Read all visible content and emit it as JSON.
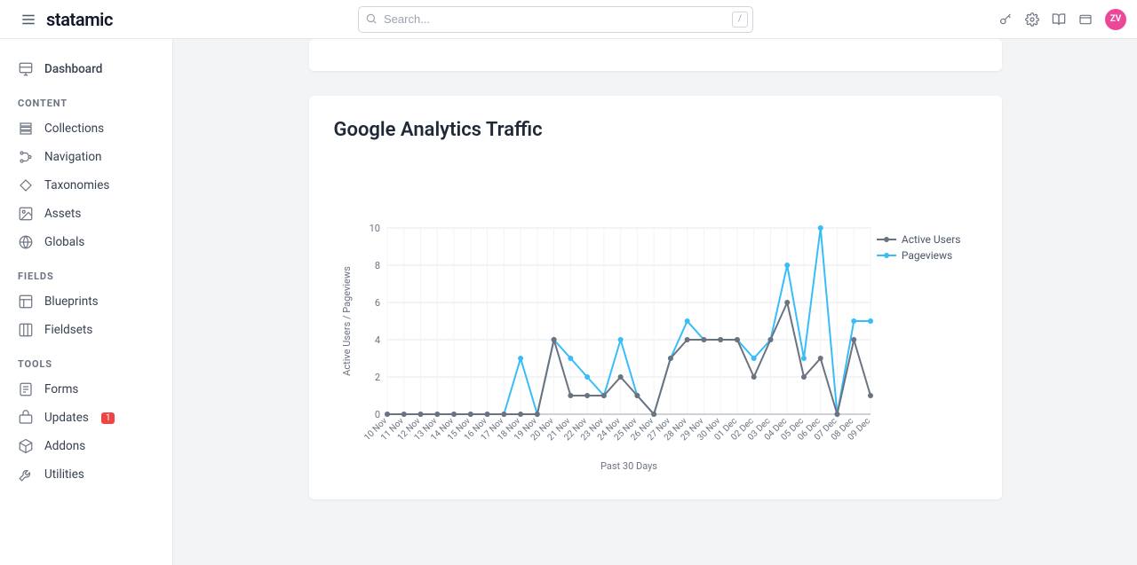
{
  "brand": "statamic",
  "search": {
    "placeholder": "Search...",
    "slash": "/"
  },
  "avatar": "ZV",
  "sidebar": {
    "dashboard": "Dashboard",
    "sections": [
      {
        "label": "CONTENT",
        "items": [
          "Collections",
          "Navigation",
          "Taxonomies",
          "Assets",
          "Globals"
        ]
      },
      {
        "label": "FIELDS",
        "items": [
          "Blueprints",
          "Fieldsets"
        ]
      },
      {
        "label": "TOOLS",
        "items": [
          "Forms",
          "Updates",
          "Addons",
          "Utilities"
        ]
      }
    ],
    "updates_badge": "1"
  },
  "card": {
    "title": "Google Analytics Traffic"
  },
  "chart_data": {
    "type": "line",
    "title": "Google Analytics Traffic",
    "xlabel": "Past 30 Days",
    "ylabel": "Active Users / Pageviews",
    "ylim": [
      0,
      10
    ],
    "yticks": [
      0,
      2,
      4,
      6,
      8,
      10
    ],
    "categories": [
      "10 Nov",
      "11 Nov",
      "12 Nov",
      "13 Nov",
      "14 Nov",
      "15 Nov",
      "16 Nov",
      "17 Nov",
      "18 Nov",
      "19 Nov",
      "20 Nov",
      "21 Nov",
      "22 Nov",
      "23 Nov",
      "24 Nov",
      "25 Nov",
      "26 Nov",
      "27 Nov",
      "28 Nov",
      "29 Nov",
      "30 Nov",
      "01 Dec",
      "02 Dec",
      "03 Dec",
      "04 Dec",
      "05 Dec",
      "06 Dec",
      "07 Dec",
      "08 Dec",
      "09 Dec"
    ],
    "series": [
      {
        "name": "Active Users",
        "color": "#6b7280",
        "values": [
          0,
          0,
          0,
          0,
          0,
          0,
          0,
          0,
          0,
          0,
          4,
          1,
          1,
          1,
          2,
          1,
          0,
          3,
          4,
          4,
          4,
          4,
          2,
          4,
          6,
          2,
          3,
          0,
          4,
          1
        ]
      },
      {
        "name": "Pageviews",
        "color": "#38bdf8",
        "values": [
          0,
          0,
          0,
          0,
          0,
          0,
          0,
          0,
          3,
          0,
          4,
          3,
          2,
          1,
          4,
          1,
          0,
          3,
          5,
          4,
          4,
          4,
          3,
          4,
          8,
          3,
          10,
          0,
          5,
          5
        ]
      }
    ]
  }
}
